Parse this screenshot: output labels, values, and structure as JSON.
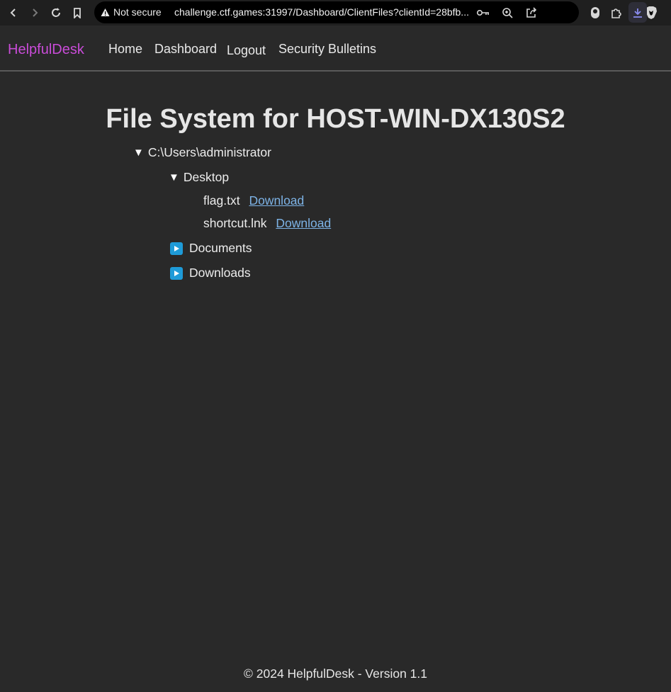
{
  "browser": {
    "security_label": "Not secure",
    "url": "challenge.ctf.games:31997/Dashboard/ClientFiles?clientId=28bfb..."
  },
  "site": {
    "brand": "HelpfulDesk",
    "brand_color": "#c94cd8",
    "nav": {
      "home": "Home",
      "dashboard": "Dashboard",
      "logout": "Logout",
      "security": "Security Bulletins"
    }
  },
  "main": {
    "title": "File System for HOST-WIN-DX130S2",
    "root": {
      "expand_glyph": "▼",
      "label": "C:\\Users\\administrator",
      "desktop": {
        "expand_glyph": "▼",
        "label": "Desktop",
        "files": [
          {
            "name": "flag.txt",
            "link": "Download"
          },
          {
            "name": "shortcut.lnk",
            "link": "Download"
          }
        ]
      },
      "documents": {
        "label": "Documents"
      },
      "downloads": {
        "label": "Downloads"
      }
    }
  },
  "footer": {
    "text": "© 2024 HelpfulDesk - Version 1.1"
  }
}
